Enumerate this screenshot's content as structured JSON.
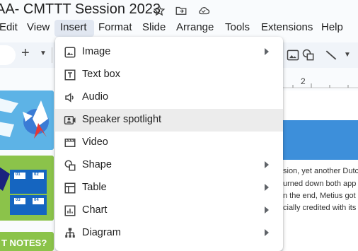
{
  "doc": {
    "title": "AA- CMTTT Session 2023"
  },
  "menubar": [
    {
      "label": "Edit"
    },
    {
      "label": "View"
    },
    {
      "label": "Insert"
    },
    {
      "label": "Format"
    },
    {
      "label": "Slide"
    },
    {
      "label": "Arrange"
    },
    {
      "label": "Tools"
    },
    {
      "label": "Extensions"
    },
    {
      "label": "Help"
    }
  ],
  "toolbar": {
    "add_label": "+",
    "ruler_mark": "2"
  },
  "insert_menu": {
    "items": [
      {
        "label": "Image",
        "icon": "image-icon",
        "submenu": true
      },
      {
        "label": "Text box",
        "icon": "text-box-icon",
        "submenu": false
      },
      {
        "label": "Audio",
        "icon": "audio-icon",
        "submenu": false
      },
      {
        "label": "Speaker spotlight",
        "icon": "speaker-spotlight-icon",
        "submenu": false,
        "highlighted": true
      },
      {
        "label": "Video",
        "icon": "video-icon",
        "submenu": false
      },
      {
        "label": "Shape",
        "icon": "shape-icon",
        "submenu": true
      },
      {
        "label": "Table",
        "icon": "table-icon",
        "submenu": true
      },
      {
        "label": "Chart",
        "icon": "chart-icon",
        "submenu": true
      },
      {
        "label": "Diagram",
        "icon": "diagram-icon",
        "submenu": true
      }
    ]
  },
  "thumbs": {
    "slide2": {
      "box1": "01",
      "box2": "02",
      "box3": "03",
      "box4": "04",
      "tail": "T NOTES?"
    }
  },
  "canvas_text": [
    "sion, yet another Dutc",
    "urned down both app",
    "n the end, Metius got a",
    "cially credited with its"
  ],
  "colors": {
    "accent": "#1a73e8",
    "menu_highlight": "#ececec",
    "slide_blue": "#3d8fda",
    "slide_green": "#8bc34a"
  }
}
